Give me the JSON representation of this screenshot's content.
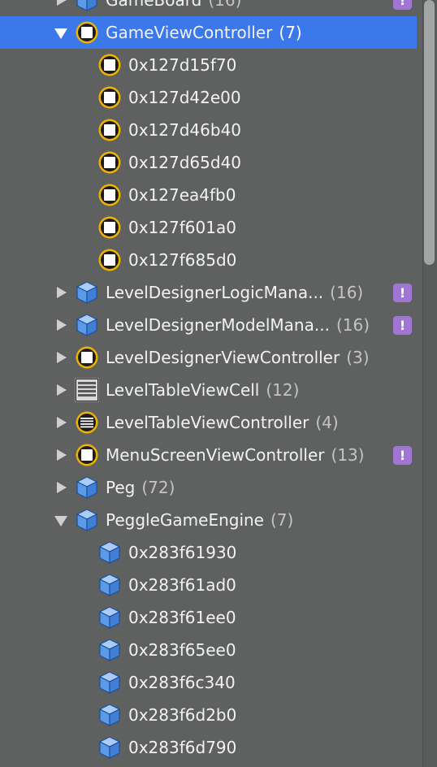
{
  "rows": [
    {
      "label": "GameBoard",
      "count": "(16)",
      "type": "cube",
      "level": 0,
      "disc": "closed",
      "warn": true
    },
    {
      "label": "GameViewController",
      "count": "(7)",
      "type": "vc",
      "level": 0,
      "disc": "open",
      "selected": true
    },
    {
      "label": "0x127d15f70",
      "type": "vc",
      "level": 1
    },
    {
      "label": "0x127d42e00",
      "type": "vc",
      "level": 1
    },
    {
      "label": "0x127d46b40",
      "type": "vc",
      "level": 1
    },
    {
      "label": "0x127d65d40",
      "type": "vc",
      "level": 1
    },
    {
      "label": "0x127ea4fb0",
      "type": "vc",
      "level": 1
    },
    {
      "label": "0x127f601a0",
      "type": "vc",
      "level": 1
    },
    {
      "label": "0x127f685d0",
      "type": "vc",
      "level": 1
    },
    {
      "label": "LevelDesignerLogicMana...",
      "count": "(16)",
      "type": "cube",
      "level": 0,
      "disc": "closed",
      "warn": true
    },
    {
      "label": "LevelDesignerModelMana...",
      "count": "(16)",
      "type": "cube",
      "level": 0,
      "disc": "closed",
      "warn": true
    },
    {
      "label": "LevelDesignerViewController",
      "count": "(3)",
      "type": "vc",
      "level": 0,
      "disc": "closed"
    },
    {
      "label": "LevelTableViewCell",
      "count": "(12)",
      "type": "cell",
      "level": 0,
      "disc": "closed"
    },
    {
      "label": "LevelTableViewController",
      "count": "(4)",
      "type": "tvc",
      "level": 0,
      "disc": "closed"
    },
    {
      "label": "MenuScreenViewController",
      "count": "(13)",
      "type": "vc",
      "level": 0,
      "disc": "closed",
      "warn": true
    },
    {
      "label": "Peg",
      "count": "(72)",
      "type": "cube",
      "level": 0,
      "disc": "closed"
    },
    {
      "label": "PeggleGameEngine",
      "count": "(7)",
      "type": "cube",
      "level": 0,
      "disc": "open"
    },
    {
      "label": "0x283f61930",
      "type": "cube",
      "level": 1
    },
    {
      "label": "0x283f61ad0",
      "type": "cube",
      "level": 1
    },
    {
      "label": "0x283f61ee0",
      "type": "cube",
      "level": 1
    },
    {
      "label": "0x283f65ee0",
      "type": "cube",
      "level": 1
    },
    {
      "label": "0x283f6c340",
      "type": "cube",
      "level": 1
    },
    {
      "label": "0x283f6d2b0",
      "type": "cube",
      "level": 1
    },
    {
      "label": "0x283f6d790",
      "type": "cube",
      "level": 1
    }
  ],
  "warn_glyph": "!",
  "colors": {
    "selection": "#3b78ea",
    "warning": "#9f76d4",
    "cube": "#4a90e2",
    "vc_ring": "#f0b400"
  }
}
